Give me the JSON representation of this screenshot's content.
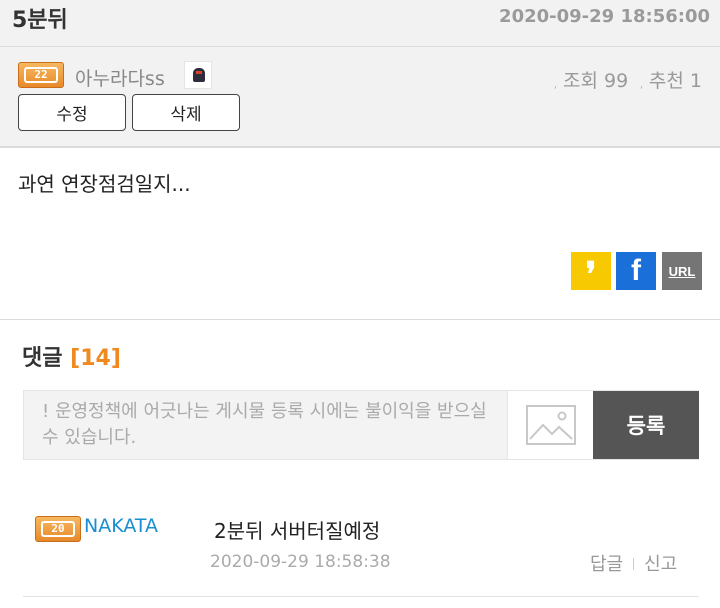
{
  "post": {
    "title": "5분뒤",
    "date": "2020-09-29 18:56:00",
    "author": {
      "level": "22",
      "name": "아누라다ss"
    },
    "stats": {
      "views_label": "조회 99",
      "recommend_label": "추천 1"
    },
    "edit_label": "수정",
    "delete_label": "삭제",
    "body": "과연 연장점검일지..."
  },
  "share": {
    "kakao_glyph": "❜",
    "facebook_glyph": "f",
    "url_label": "URL",
    "colors": {
      "kakao": "#f7c900",
      "facebook": "#1a6fd8",
      "url": "#757575"
    }
  },
  "comments": {
    "title": "댓글",
    "count_label": "[14]",
    "input_placeholder": "! 운영정책에 어긋나는 게시물 등록 시에는 불이익을 받으실 수 있습니다.",
    "image_icon": "image-icon",
    "submit_label": "등록",
    "items": [
      {
        "level": "20",
        "nickname": "NAKATA",
        "text": "2분뒤 서버터질예정",
        "date": "2020-09-29 18:58:38",
        "reply_label": "답글",
        "report_label": "신고"
      }
    ]
  },
  "colors": {
    "accent": "#f08a1e",
    "nickname": "#1a8fd0",
    "badge": "#e8892a"
  }
}
